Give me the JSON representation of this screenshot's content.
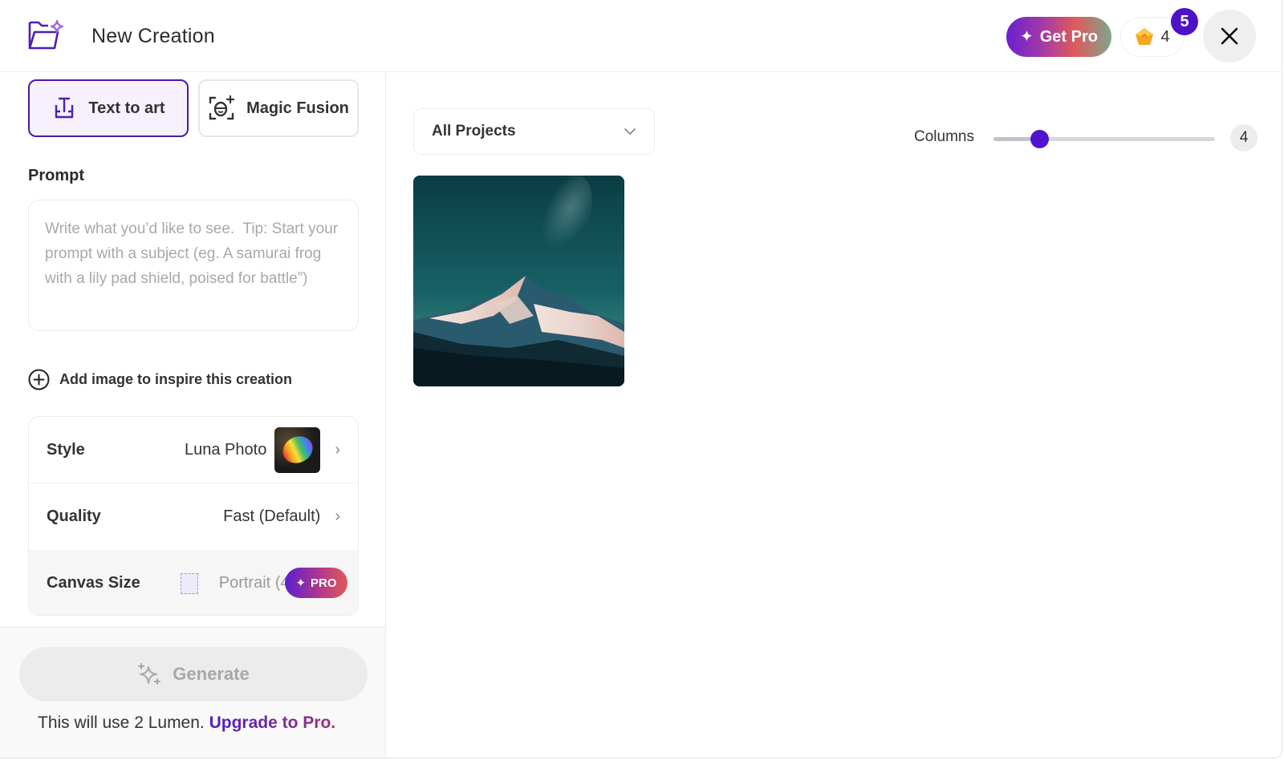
{
  "header": {
    "title": "New Creation",
    "get_pro_label": "Get Pro",
    "lumen_count": "4",
    "notification_count": "5"
  },
  "modes": [
    {
      "label": "Text to art",
      "active": true
    },
    {
      "label": "Magic Fusion",
      "active": false
    }
  ],
  "prompt": {
    "label": "Prompt",
    "value": "",
    "placeholder": "Write what you’d like to see.  Tip: Start your prompt with a subject (eg. A samurai frog with a lily pad shield, poised for battle”)"
  },
  "add_image_label": "Add image to inspire this creation",
  "settings": {
    "style": {
      "label": "Style",
      "value": "Luna Photo"
    },
    "quality": {
      "label": "Quality",
      "value": "Fast (Default)"
    },
    "canvas": {
      "label": "Canvas Size",
      "value": "Portrait (4",
      "pro_label": "PRO"
    }
  },
  "footer": {
    "generate_label": "Generate",
    "note_text": "This will use 2 Lumen.",
    "upgrade_link": "Upgrade to Pro."
  },
  "gallery": {
    "project_filter": "All Projects",
    "columns_label": "Columns",
    "columns_value": "4",
    "columns_slider_fraction": 0.21,
    "items": [
      {
        "description": "Snow-capped mountain under teal night sky with milky way"
      }
    ]
  },
  "colors": {
    "accent": "#5014d0",
    "badge": "#4d12c7",
    "active_border": "#4a1aa8"
  }
}
